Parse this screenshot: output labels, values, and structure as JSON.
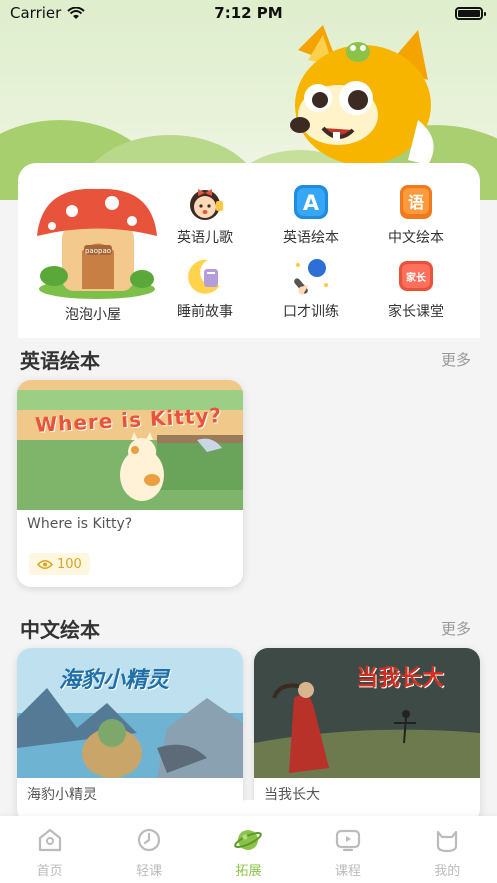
{
  "status_bar": {
    "carrier": "Carrier",
    "time": "7:12 PM"
  },
  "menu": {
    "house_label": "泡泡小屋",
    "house_sign": "paopao",
    "items": [
      {
        "label": "英语儿歌",
        "icon": "singing-girl-icon"
      },
      {
        "label": "英语绘本",
        "icon": "letter-a-icon",
        "icon_text": "A"
      },
      {
        "label": "中文绘本",
        "icon": "chinese-book-icon",
        "icon_text": "语"
      },
      {
        "label": "睡前故事",
        "icon": "moon-icon"
      },
      {
        "label": "口才训练",
        "icon": "microphone-icon"
      },
      {
        "label": "家长课堂",
        "icon": "parent-tag-icon",
        "icon_text": "家长"
      }
    ]
  },
  "english_section": {
    "title": "英语绘本",
    "more": "更多",
    "books": [
      {
        "title": "Where is Kitty?",
        "cover_text": "Where is Kitty?",
        "views": "100"
      }
    ]
  },
  "chinese_section": {
    "title": "中文绘本",
    "more": "更多",
    "books": [
      {
        "title": "海豹小精灵",
        "cover_text": "海豹小精灵"
      },
      {
        "title": "当我长大",
        "cover_text": "当我长大"
      }
    ]
  },
  "tabs": [
    {
      "label": "首页",
      "icon": "home-icon",
      "active": false
    },
    {
      "label": "轻课",
      "icon": "clock-icon",
      "active": false
    },
    {
      "label": "拓展",
      "icon": "planet-icon",
      "active": true
    },
    {
      "label": "课程",
      "icon": "play-screen-icon",
      "active": false
    },
    {
      "label": "我的",
      "icon": "cat-face-icon",
      "active": false
    }
  ],
  "colors": {
    "accent": "#8bc34a",
    "badge_text": "#d9a520",
    "muted": "#999999"
  }
}
